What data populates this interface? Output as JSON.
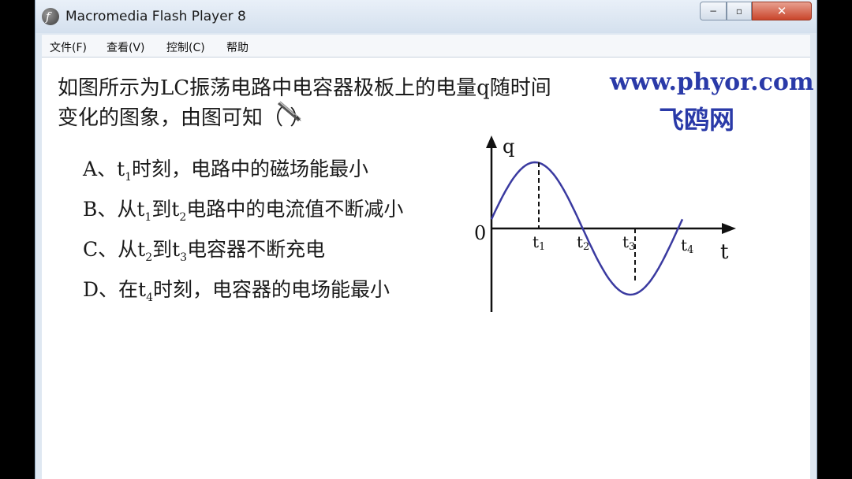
{
  "window": {
    "title": "Macromedia Flash Player 8",
    "controls": {
      "minimize": "−",
      "maximize": "▫",
      "close": "✕"
    }
  },
  "menu": [
    "文件(F)",
    "查看(V)",
    "控制(C)",
    "帮助"
  ],
  "question": {
    "line1": "如图所示为LC振荡电路中电容器极板上的电量q随时间",
    "line2": "变化的图象，由图可知（        ）"
  },
  "options": [
    {
      "prefix": "A、",
      "parts": [
        [
          "t",
          "1"
        ],
        [
          "时刻，电路中的磁场能最小",
          ""
        ]
      ]
    },
    {
      "prefix": "B、从",
      "parts": [
        [
          "t",
          "1"
        ],
        [
          "到",
          ""
        ],
        [
          "t",
          "2"
        ],
        [
          "电路中的电流值不断减小",
          ""
        ]
      ]
    },
    {
      "prefix": "C、从",
      "parts": [
        [
          "t",
          "2"
        ],
        [
          "到",
          ""
        ],
        [
          "t",
          "3"
        ],
        [
          "电容器不断充电",
          ""
        ]
      ]
    },
    {
      "prefix": "D、在",
      "parts": [
        [
          "t",
          "4"
        ],
        [
          "时刻，电容器的电场能最小",
          ""
        ]
      ]
    }
  ],
  "brand": {
    "url": "www.phyor.com",
    "name": "飞鸥网"
  },
  "graph": {
    "y_label": "q",
    "x_label": "t",
    "origin_label": "0",
    "ticks": [
      {
        "t": "t",
        "sub": "1"
      },
      {
        "t": "t",
        "sub": "2"
      },
      {
        "t": "t",
        "sub": "3"
      },
      {
        "t": "t",
        "sub": "4"
      }
    ]
  },
  "colors": {
    "curve": "#3a3aa0",
    "brand": "#2a3aa8",
    "close": "#c9452b"
  }
}
